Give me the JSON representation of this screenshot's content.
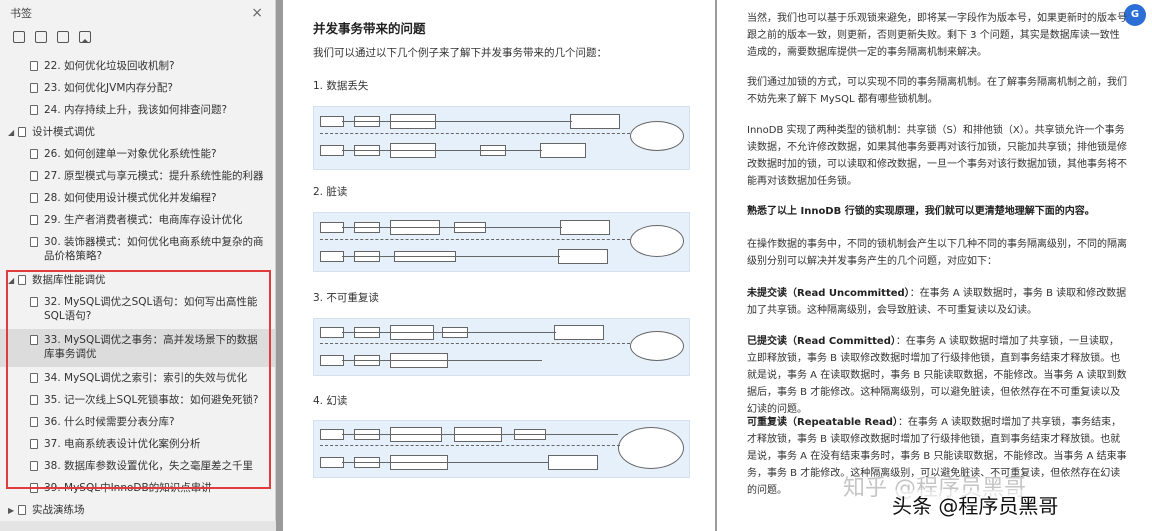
{
  "sidebar": {
    "title": "书签",
    "close_glyph": "×",
    "tools": [
      "expand-all-icon",
      "collapse-all-icon",
      "bookmark-add-icon",
      "bookmark-icon"
    ],
    "items": [
      {
        "level": 2,
        "label": "22. 如何优化垃圾回收机制?"
      },
      {
        "level": 2,
        "label": "23. 如何优化JVM内存分配?"
      },
      {
        "level": 2,
        "label": "24. 内存持续上升，我该如何排查问题?"
      },
      {
        "level": 1,
        "label": "设计模式调优",
        "caret": "◢"
      },
      {
        "level": 2,
        "label": "26. 如何创建单一对象优化系统性能?"
      },
      {
        "level": 2,
        "label": "27. 原型模式与享元模式：提升系统性能的利器"
      },
      {
        "level": 2,
        "label": "28. 如何使用设计模式优化并发编程?"
      },
      {
        "level": 2,
        "label": "29. 生产者消费者模式：电商库存设计优化"
      },
      {
        "level": 2,
        "label": "30. 装饰器模式：如何优化电商系统中复杂的商品价格策略?"
      },
      {
        "level": 1,
        "label": "数据库性能调优",
        "caret": "◢"
      },
      {
        "level": 2,
        "label": "32. MySQL调优之SQL语句：如何写出高性能SQL语句?"
      },
      {
        "level": 2,
        "label": "33. MySQL调优之事务：高并发场景下的数据库事务调优",
        "selected": true
      },
      {
        "level": 2,
        "label": "34. MySQL调优之索引：索引的失效与优化"
      },
      {
        "level": 2,
        "label": "35. 记一次线上SQL死锁事故：如何避免死锁?"
      },
      {
        "level": 2,
        "label": "36. 什么时候需要分表分库?"
      },
      {
        "level": 2,
        "label": "37. 电商系统表设计优化案例分析"
      },
      {
        "level": 2,
        "label": "38. 数据库参数设置优化，失之毫厘差之千里"
      },
      {
        "level": 2,
        "label": "39. MySQL中InnoDB的知识点串讲"
      },
      {
        "level": 1,
        "label": "实战演练场",
        "caret": "▶"
      }
    ]
  },
  "left_page": {
    "title": "并发事务带来的问题",
    "intro": "我们可以通过以下几个例子来了解下并发事务带来的几个问题：",
    "sections": [
      "1. 数据丢失",
      "2. 脏读",
      "3. 不可重复读",
      "4. 幻读"
    ]
  },
  "right_page": {
    "p1": "当然，我们也可以基于乐观锁来避免，即将某一字段作为版本号，如果更新时的版本号跟之前的版本一致，则更新，否则更新失败。剩下 3 个问题，其实是数据库读一致性造成的，需要数据库提供一定的事务隔离机制来解决。",
    "p2": "我们通过加锁的方式，可以实现不同的事务隔离机制。在了解事务隔离机制之前，我们不妨先来了解下 MySQL 都有哪些锁机制。",
    "p3": "InnoDB 实现了两种类型的锁机制：共享锁（S）和排他锁（X）。共享锁允许一个事务读数据，不允许修改数据，如果其他事务要再对该行加锁，只能加共享锁；排他锁是修改数据时加的锁，可以读取和修改数据，一旦一个事务对该行数据加锁，其他事务将不能再对该数据加任务锁。",
    "p4": "熟悉了以上 InnoDB 行锁的实现原理，我们就可以更清楚地理解下面的内容。",
    "p5": "在操作数据的事务中，不同的锁机制会产生以下几种不同的事务隔离级别，不同的隔离级别分别可以解决并发事务产生的几个问题，对应如下：",
    "p6_head": "未提交读（Read Uncommitted）",
    "p6_body": "：在事务 A 读取数据时，事务 B 读取和修改数据加了共享锁。这种隔离级别，会导致脏读、不可重复读以及幻读。",
    "p7_head": "已提交读（Read Committed）",
    "p7_body": "：在事务 A 读取数据时增加了共享锁，一旦读取，立即释放锁，事务 B 读取修改数据时增加了行级排他锁，直到事务结束才释放锁。也就是说，事务 A 在读取数据时，事务 B 只能读取数据，不能修改。当事务 A 读取到数据后，事务 B 才能修改。这种隔离级别，可以避免脏读，但依然存在不可重复读以及幻读的问题。",
    "p8_head": "可重复读（Repeatable Read）",
    "p8_body": "：在事务 A 读取数据时增加了共享锁，事务结束，才释放锁，事务 B 读取修改数据时增加了行级排他锁，直到事务结束才释放锁。也就是说，事务 A 在没有结束事务时，事务 B 只能读取数据，不能修改。当事务 A 结束事务，事务 B 才能修改。这种隔离级别，可以避免脏读、不可重复读，但依然存在幻读的问题。",
    "watermark_zhihu": "知乎 @程序员黑哥",
    "watermark_toutiao": "头条 @程序员黑哥",
    "fab_label": "G"
  }
}
